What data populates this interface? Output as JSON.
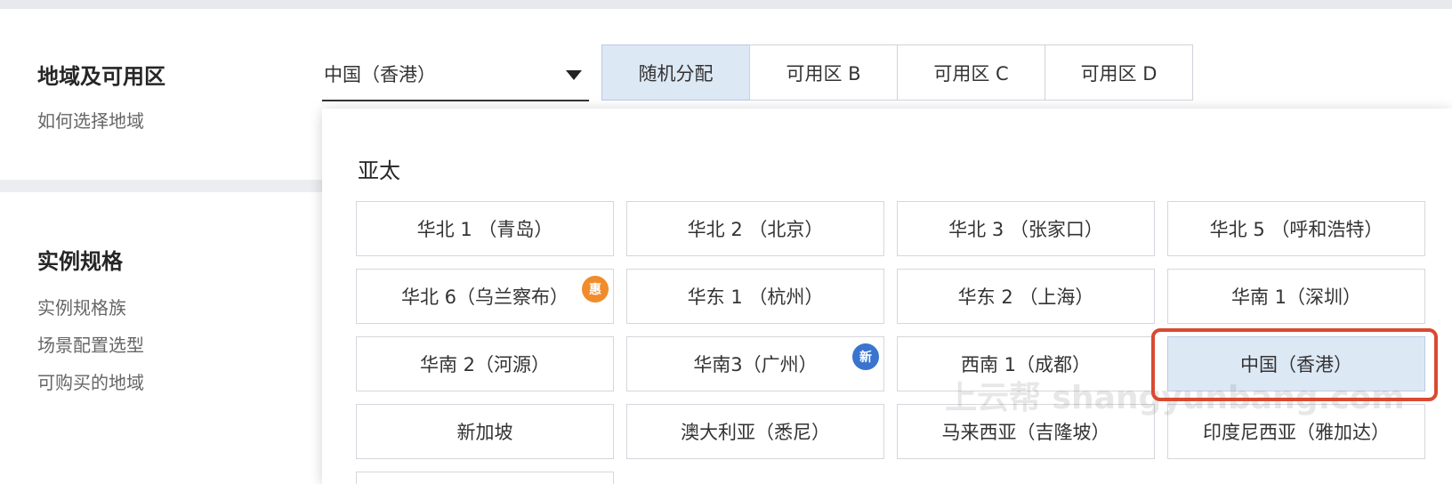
{
  "section1": {
    "title": "地域及可用区",
    "help_link": "如何选择地域",
    "selected_region": "中国（香港）",
    "zone_tabs": [
      {
        "label": "随机分配",
        "active": true
      },
      {
        "label": "可用区 B",
        "active": false
      },
      {
        "label": "可用区 C",
        "active": false
      },
      {
        "label": "可用区 D",
        "active": false
      }
    ]
  },
  "section2": {
    "title": "实例规格",
    "links": [
      "实例规格族",
      "场景配置选型",
      "可购买的地域"
    ]
  },
  "dropdown": {
    "group_title": "亚太",
    "regions": [
      [
        "华北 1 （青岛）",
        "华北 2 （北京）",
        "华北 3 （张家口）",
        "华北 5 （呼和浩特）"
      ],
      [
        "华北 6（乌兰察布）",
        "华东 1 （杭州）",
        "华东 2 （上海）",
        "华南 1（深圳）"
      ],
      [
        "华南 2（河源）",
        "华南3（广州）",
        "西南 1（成都）",
        "中国（香港）"
      ],
      [
        "新加坡",
        "澳大利亚（悉尼）",
        "马来西亚（吉隆坡）",
        "印度尼西亚（雅加达）"
      ]
    ],
    "badges": {
      "hui": "惠",
      "xin": "新"
    }
  },
  "watermark": "上云帮 shangyunbang.com",
  "colors": {
    "selected_bg": "#dde8f5",
    "highlight": "#d94a32",
    "badge_orange": "#f08c2b",
    "badge_blue": "#3a74cf"
  }
}
